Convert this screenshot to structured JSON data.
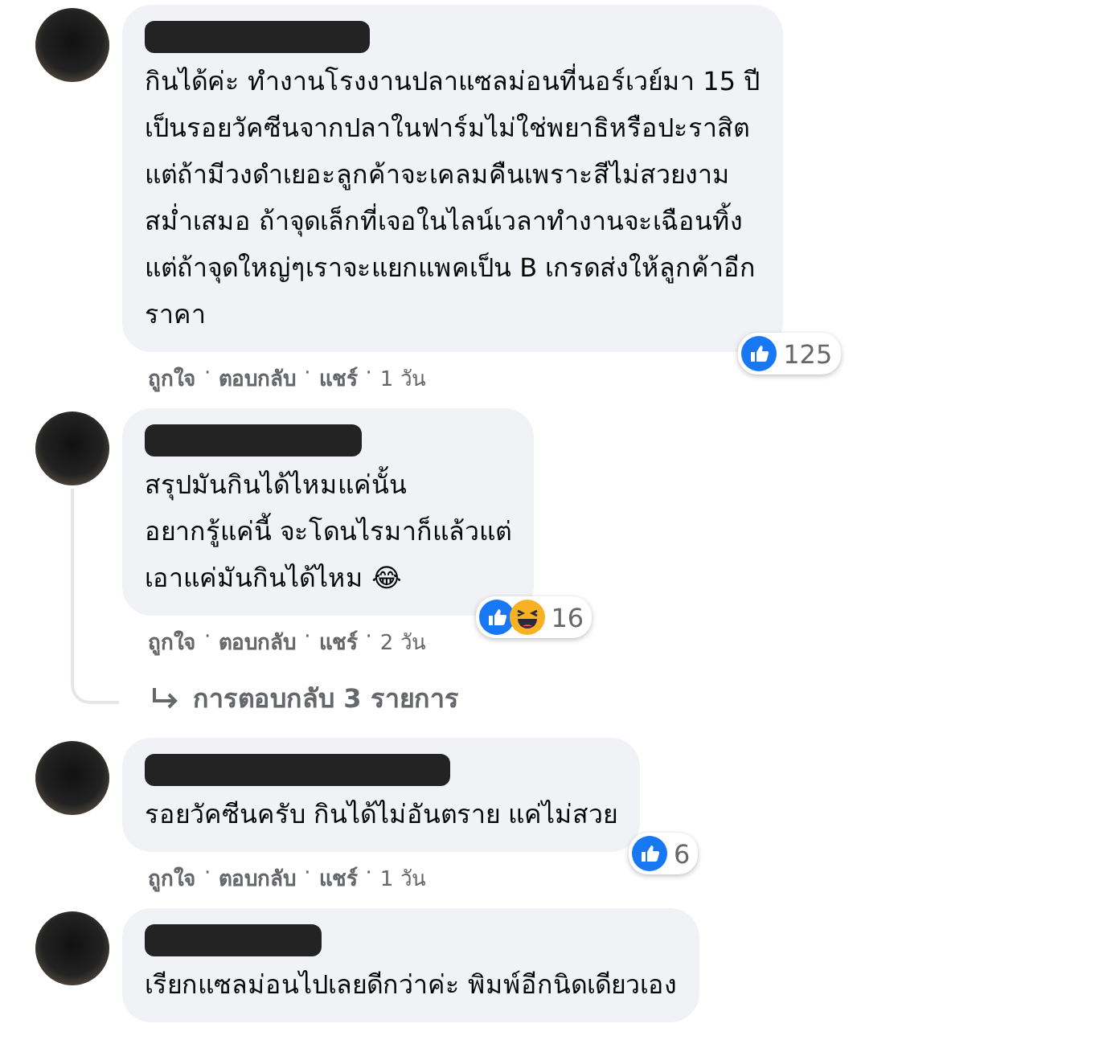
{
  "comments": [
    {
      "name_redacted": true,
      "lines": [
        "กินได้ค่ะ ทำงานโรงงานปลาแซลม่อนที่นอร์เวย์มา 15 ปี",
        "เป็นรอยวัคซีนจากปลาในฟาร์มไม่ใช่พยาธิหรือปะราสิต",
        "แต่ถ้ามีวงดำเยอะลูกค้าจะเคลมคืนเพราะสีไม่สวยงาม",
        "สม่ำเสมอ ถ้าจุดเล็กที่เจอในไลน์เวลาทำงานจะเฉือนทิ้ง",
        "แต่ถ้าจุดใหญ่ๆเราจะแยกแพคเป็น B เกรดส่งให้ลูกค้าอีก",
        "ราคา"
      ],
      "reactions": {
        "icons": [
          {
            "kind": "like"
          }
        ],
        "count": "125"
      },
      "actions": [
        "ถูกใจ",
        "ตอบกลับ",
        "แชร์"
      ],
      "separator": "·",
      "time": "1 วัน"
    },
    {
      "name_redacted": true,
      "lines": [
        "สรุปมันกินได้ไหมแค่นั้น",
        "อยากรู้แค่นี้ จะโดนไรมาก็แล้วแต่",
        "เอาแค่มันกินได้ไหม 😂"
      ],
      "reactions": {
        "icons": [
          {
            "kind": "like"
          },
          {
            "kind": "haha"
          }
        ],
        "count": "16"
      },
      "actions": [
        "ถูกใจ",
        "ตอบกลับ",
        "แชร์"
      ],
      "separator": "·",
      "time": "2 วัน",
      "replies_link": "การตอบกลับ 3 รายการ"
    },
    {
      "name_redacted": true,
      "lines": [
        "รอยวัคซีนครับ กินได้ไม่อันตราย แค่ไม่สวย"
      ],
      "reactions": {
        "icons": [
          {
            "kind": "like"
          }
        ],
        "count": "6"
      },
      "actions": [
        "ถูกใจ",
        "ตอบกลับ",
        "แชร์"
      ],
      "separator": "·",
      "time": "1 วัน"
    },
    {
      "name_redacted": true,
      "lines": [
        "เรียกแซลม่อนไปเลยดีกว่าค่ะ พิมพ์อีกนิดเดียวเอง"
      ]
    }
  ]
}
